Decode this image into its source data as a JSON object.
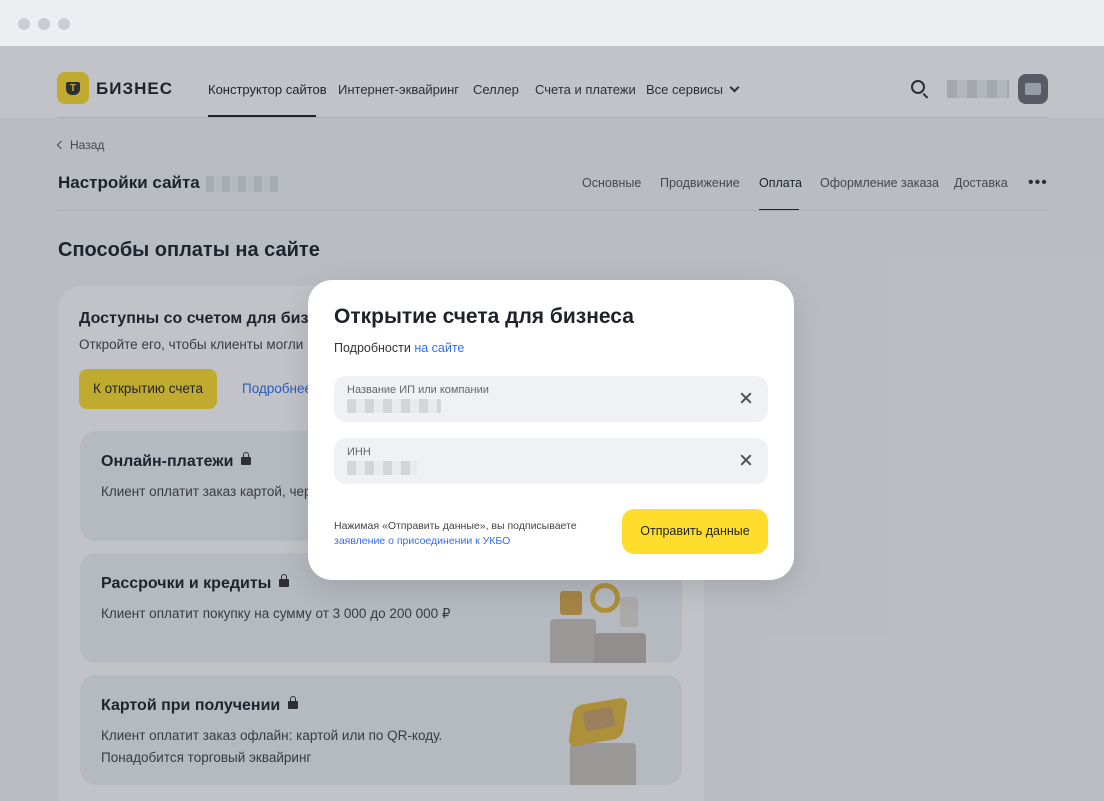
{
  "header": {
    "brand": "БИЗНЕС",
    "nav": [
      "Конструктор сайтов",
      "Интернет-эквайринг",
      "Селлер",
      "Счета и платежи",
      "Все сервисы"
    ]
  },
  "page": {
    "back_label": "Назад",
    "title": "Настройки сайта",
    "tabs": [
      "Основные",
      "Продвижение",
      "Оплата",
      "Оформление заказа",
      "Доставка"
    ],
    "active_tab": "Оплата",
    "section_title": "Способы оплаты на сайте"
  },
  "card": {
    "heading": "Доступны со счетом для бизнеса",
    "subtext": "Откройте его, чтобы клиенты могли",
    "open_button": "К открытию счета",
    "more_link": "Подробнее",
    "methods": [
      {
        "title": "Онлайн-платежи",
        "desc": "Клиент оплатит заказ картой, через"
      },
      {
        "title": "Рассрочки и кредиты",
        "desc": "Клиент оплатит покупку на сумму от 3 000 до 200 000 ₽"
      },
      {
        "title": "Картой при получении",
        "desc1": "Клиент оплатит заказ офлайн: картой или по QR-коду.",
        "desc2": "Понадобится торговый эквайринг"
      }
    ]
  },
  "modal": {
    "title": "Открытие счета для бизнеса",
    "subtitle_prefix": "Подробности",
    "subtitle_link": "на сайте",
    "fields": [
      {
        "label": "Название ИП или компании"
      },
      {
        "label": "ИНН"
      }
    ],
    "consent_text": "Нажимая «Отправить данные», вы подписываете",
    "consent_link": "заявление о присоединении к УКБО",
    "submit_label": "Отправить данные"
  },
  "colors": {
    "accent_yellow": "#ffdd2d",
    "link_blue": "#336fee",
    "overlay": "rgba(33,41,58,0.28)"
  }
}
